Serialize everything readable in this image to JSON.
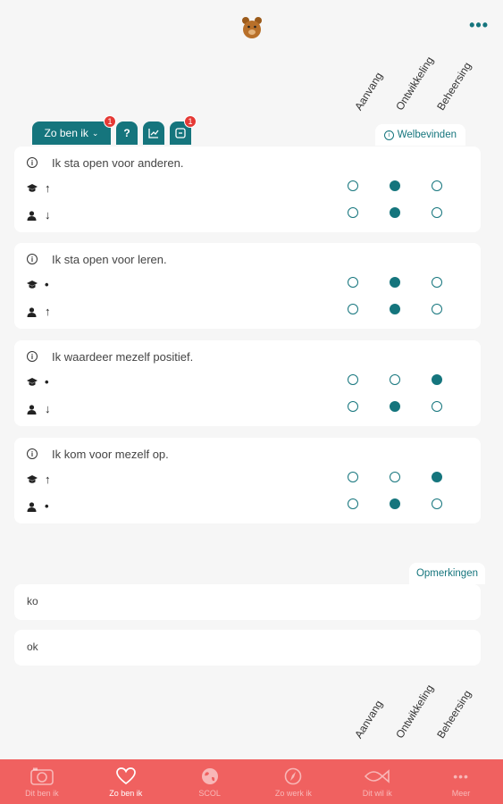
{
  "topbar": {
    "more_icon": "more-dots-icon",
    "mascot": "bear-icon"
  },
  "columns": [
    "Aanvang",
    "Ontwikkeling",
    "Beheersing"
  ],
  "tabs": [
    {
      "label": "Zo ben ik",
      "badge": "1"
    },
    {
      "label": "?",
      "badge": ""
    },
    {
      "label": "chart-icon",
      "badge": ""
    },
    {
      "label": "note-icon",
      "badge": "1"
    }
  ],
  "welbevinden_label": "Welbevinden",
  "statements": [
    {
      "text": "Ik sta open voor anderen.",
      "teacher_trend": "↑",
      "self_trend": "↓",
      "teacher_level": 2,
      "self_level": 2
    },
    {
      "text": "Ik sta open voor leren.",
      "teacher_trend": "•",
      "self_trend": "↑",
      "teacher_level": 2,
      "self_level": 2
    },
    {
      "text": "Ik waardeer mezelf positief.",
      "teacher_trend": "•",
      "self_trend": "↓",
      "teacher_level": 3,
      "self_level": 2
    },
    {
      "text": "Ik kom voor mezelf op.",
      "teacher_trend": "↑",
      "self_trend": "•",
      "teacher_level": 3,
      "self_level": 2
    }
  ],
  "opmerkingen_label": "Opmerkingen",
  "notes": [
    "ko",
    "ok"
  ],
  "nav": [
    {
      "label": "Dit ben ik",
      "icon": "camera-icon",
      "active": false
    },
    {
      "label": "Zo ben ik",
      "icon": "heart-icon",
      "active": true
    },
    {
      "label": "SCOL",
      "icon": "globe-icon",
      "active": false
    },
    {
      "label": "Zo werk ik",
      "icon": "compass-icon",
      "active": false
    },
    {
      "label": "Dit wil ik",
      "icon": "fish-icon",
      "active": false
    },
    {
      "label": "Meer",
      "icon": "more-icon",
      "active": false
    }
  ],
  "colors": {
    "accent": "#15757d",
    "nav_bg": "#f06160",
    "badge": "#e53935"
  }
}
